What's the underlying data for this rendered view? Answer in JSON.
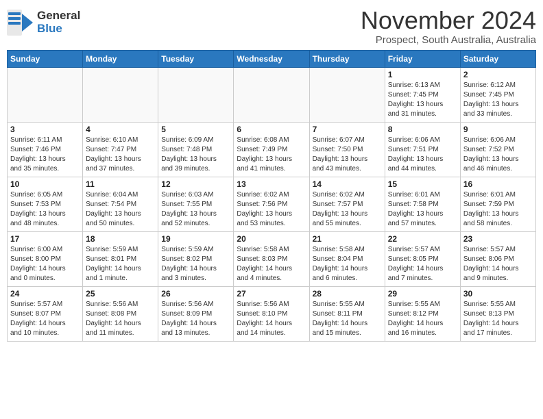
{
  "logo": {
    "text_general": "General",
    "text_blue": "Blue"
  },
  "header": {
    "month": "November 2024",
    "location": "Prospect, South Australia, Australia"
  },
  "weekdays": [
    "Sunday",
    "Monday",
    "Tuesday",
    "Wednesday",
    "Thursday",
    "Friday",
    "Saturday"
  ],
  "weeks": [
    [
      {
        "day": "",
        "info": ""
      },
      {
        "day": "",
        "info": ""
      },
      {
        "day": "",
        "info": ""
      },
      {
        "day": "",
        "info": ""
      },
      {
        "day": "",
        "info": ""
      },
      {
        "day": "1",
        "info": "Sunrise: 6:13 AM\nSunset: 7:45 PM\nDaylight: 13 hours\nand 31 minutes."
      },
      {
        "day": "2",
        "info": "Sunrise: 6:12 AM\nSunset: 7:45 PM\nDaylight: 13 hours\nand 33 minutes."
      }
    ],
    [
      {
        "day": "3",
        "info": "Sunrise: 6:11 AM\nSunset: 7:46 PM\nDaylight: 13 hours\nand 35 minutes."
      },
      {
        "day": "4",
        "info": "Sunrise: 6:10 AM\nSunset: 7:47 PM\nDaylight: 13 hours\nand 37 minutes."
      },
      {
        "day": "5",
        "info": "Sunrise: 6:09 AM\nSunset: 7:48 PM\nDaylight: 13 hours\nand 39 minutes."
      },
      {
        "day": "6",
        "info": "Sunrise: 6:08 AM\nSunset: 7:49 PM\nDaylight: 13 hours\nand 41 minutes."
      },
      {
        "day": "7",
        "info": "Sunrise: 6:07 AM\nSunset: 7:50 PM\nDaylight: 13 hours\nand 43 minutes."
      },
      {
        "day": "8",
        "info": "Sunrise: 6:06 AM\nSunset: 7:51 PM\nDaylight: 13 hours\nand 44 minutes."
      },
      {
        "day": "9",
        "info": "Sunrise: 6:06 AM\nSunset: 7:52 PM\nDaylight: 13 hours\nand 46 minutes."
      }
    ],
    [
      {
        "day": "10",
        "info": "Sunrise: 6:05 AM\nSunset: 7:53 PM\nDaylight: 13 hours\nand 48 minutes."
      },
      {
        "day": "11",
        "info": "Sunrise: 6:04 AM\nSunset: 7:54 PM\nDaylight: 13 hours\nand 50 minutes."
      },
      {
        "day": "12",
        "info": "Sunrise: 6:03 AM\nSunset: 7:55 PM\nDaylight: 13 hours\nand 52 minutes."
      },
      {
        "day": "13",
        "info": "Sunrise: 6:02 AM\nSunset: 7:56 PM\nDaylight: 13 hours\nand 53 minutes."
      },
      {
        "day": "14",
        "info": "Sunrise: 6:02 AM\nSunset: 7:57 PM\nDaylight: 13 hours\nand 55 minutes."
      },
      {
        "day": "15",
        "info": "Sunrise: 6:01 AM\nSunset: 7:58 PM\nDaylight: 13 hours\nand 57 minutes."
      },
      {
        "day": "16",
        "info": "Sunrise: 6:01 AM\nSunset: 7:59 PM\nDaylight: 13 hours\nand 58 minutes."
      }
    ],
    [
      {
        "day": "17",
        "info": "Sunrise: 6:00 AM\nSunset: 8:00 PM\nDaylight: 14 hours\nand 0 minutes."
      },
      {
        "day": "18",
        "info": "Sunrise: 5:59 AM\nSunset: 8:01 PM\nDaylight: 14 hours\nand 1 minute."
      },
      {
        "day": "19",
        "info": "Sunrise: 5:59 AM\nSunset: 8:02 PM\nDaylight: 14 hours\nand 3 minutes."
      },
      {
        "day": "20",
        "info": "Sunrise: 5:58 AM\nSunset: 8:03 PM\nDaylight: 14 hours\nand 4 minutes."
      },
      {
        "day": "21",
        "info": "Sunrise: 5:58 AM\nSunset: 8:04 PM\nDaylight: 14 hours\nand 6 minutes."
      },
      {
        "day": "22",
        "info": "Sunrise: 5:57 AM\nSunset: 8:05 PM\nDaylight: 14 hours\nand 7 minutes."
      },
      {
        "day": "23",
        "info": "Sunrise: 5:57 AM\nSunset: 8:06 PM\nDaylight: 14 hours\nand 9 minutes."
      }
    ],
    [
      {
        "day": "24",
        "info": "Sunrise: 5:57 AM\nSunset: 8:07 PM\nDaylight: 14 hours\nand 10 minutes."
      },
      {
        "day": "25",
        "info": "Sunrise: 5:56 AM\nSunset: 8:08 PM\nDaylight: 14 hours\nand 11 minutes."
      },
      {
        "day": "26",
        "info": "Sunrise: 5:56 AM\nSunset: 8:09 PM\nDaylight: 14 hours\nand 13 minutes."
      },
      {
        "day": "27",
        "info": "Sunrise: 5:56 AM\nSunset: 8:10 PM\nDaylight: 14 hours\nand 14 minutes."
      },
      {
        "day": "28",
        "info": "Sunrise: 5:55 AM\nSunset: 8:11 PM\nDaylight: 14 hours\nand 15 minutes."
      },
      {
        "day": "29",
        "info": "Sunrise: 5:55 AM\nSunset: 8:12 PM\nDaylight: 14 hours\nand 16 minutes."
      },
      {
        "day": "30",
        "info": "Sunrise: 5:55 AM\nSunset: 8:13 PM\nDaylight: 14 hours\nand 17 minutes."
      }
    ]
  ]
}
